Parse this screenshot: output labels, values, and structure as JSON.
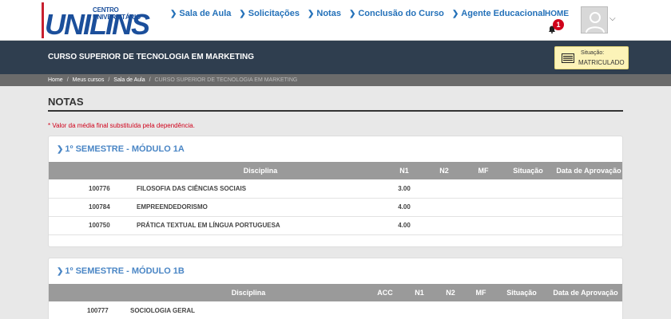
{
  "logo": {
    "subtitle": "CENTRO UNIVERSITÁRIO",
    "name": "UNILINS"
  },
  "nav": [
    {
      "label": "Sala de Aula"
    },
    {
      "label": "Solicitações"
    },
    {
      "label": "Notas"
    },
    {
      "label": "Conclusão do Curso"
    },
    {
      "label": "Agente Educacional"
    }
  ],
  "header": {
    "home_label": "HOME",
    "notification_count": "1"
  },
  "course": {
    "title": "CURSO SUPERIOR DE TECNOLOGIA EM MARKETING",
    "status_label": "Situação:",
    "status_value": "MATRICULADO"
  },
  "breadcrumb": [
    "Home",
    "Meus cursos",
    "Sala de Aula",
    "CURSO SUPERIOR DE TECNOLOGIA EM MARKETING"
  ],
  "page": {
    "title": "NOTAS",
    "note": "* Valor da média final substituída pela dependência."
  },
  "semesters": [
    {
      "title": "1º SEMESTRE - MÓDULO 1A",
      "columns": [
        "Disciplina",
        "N1",
        "N2",
        "MF",
        "Situação",
        "Data de Aprovação"
      ],
      "rows": [
        {
          "code": "100776",
          "name": "FILOSOFIA DAS CIÊNCIAS SOCIAIS",
          "n1": "3.00",
          "n2": "",
          "mf": "",
          "situacao": "",
          "data": ""
        },
        {
          "code": "100784",
          "name": "EMPREENDEDORISMO",
          "n1": "4.00",
          "n2": "",
          "mf": "",
          "situacao": "",
          "data": ""
        },
        {
          "code": "100750",
          "name": "PRÁTICA TEXTUAL EM LÍNGUA PORTUGUESA",
          "n1": "4.00",
          "n2": "",
          "mf": "",
          "situacao": "",
          "data": ""
        }
      ]
    },
    {
      "title": "1º SEMESTRE - MÓDULO 1B",
      "columns": [
        "Disciplina",
        "ACC",
        "N1",
        "N2",
        "MF",
        "Situação",
        "Data de Aprovação"
      ],
      "rows": [
        {
          "code": "100777",
          "name": "SOCIOLOGIA GERAL",
          "acc": "",
          "n1": "",
          "n2": "",
          "mf": "",
          "situacao": "",
          "data": ""
        }
      ]
    }
  ],
  "colors": {
    "brand_blue": "#1b4f9b",
    "link_blue": "#2471b9",
    "banner": "#2f3e4f",
    "alert_red": "#d0021b"
  }
}
